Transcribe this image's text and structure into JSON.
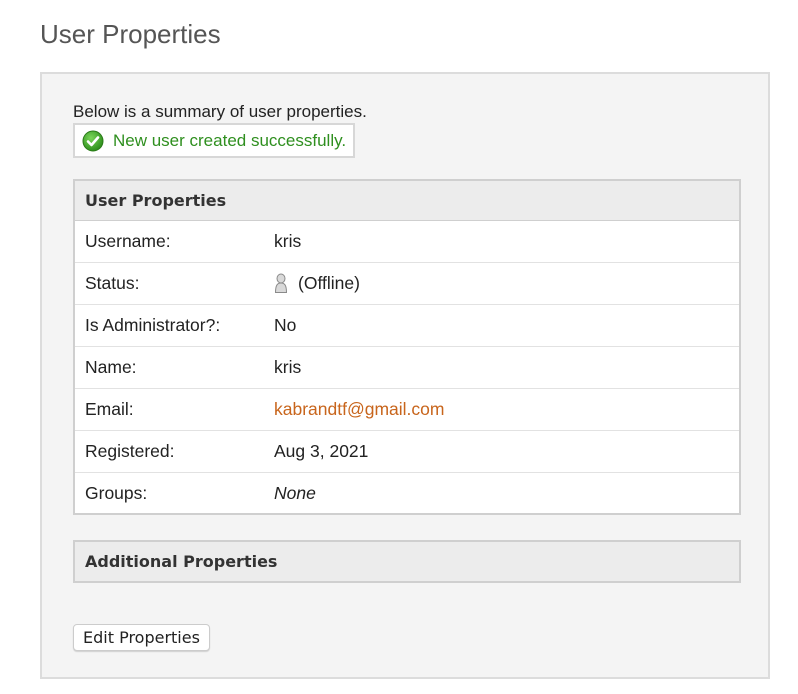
{
  "page": {
    "title": "User Properties"
  },
  "summary": {
    "intro": "Below is a summary of user properties.",
    "success_message": "New user created successfully.",
    "success_icon": "check-circle-icon"
  },
  "user_properties": {
    "header": "User Properties",
    "rows": [
      {
        "label": "Username:",
        "value": "kris"
      },
      {
        "label": "Status:",
        "value": "(Offline)",
        "icon": "user-offline-icon"
      },
      {
        "label": "Is Administrator?:",
        "value": "No"
      },
      {
        "label": "Name:",
        "value": "kris"
      },
      {
        "label": "Email:",
        "value": "kabrandtf@gmail.com"
      },
      {
        "label": "Registered:",
        "value": "Aug 3, 2021"
      },
      {
        "label": "Groups:",
        "value": "None"
      }
    ]
  },
  "additional_properties": {
    "header": "Additional Properties"
  },
  "actions": {
    "edit_label": "Edit Properties"
  },
  "colors": {
    "success": "#2f8f1f",
    "link": "#c8651c",
    "panel_bg": "#f4f4f4",
    "header_bg": "#ececec"
  }
}
